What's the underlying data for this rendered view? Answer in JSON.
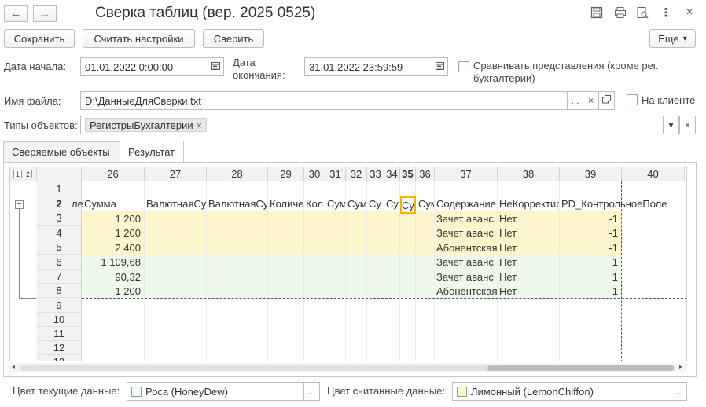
{
  "window": {
    "title": "Сверка таблиц (вер. 2025 0525)",
    "nav_back": "←",
    "nav_forward": "→",
    "menu_icon": "⋮",
    "close_icon": "×"
  },
  "toolbar": {
    "save": "Сохранить",
    "read_settings": "Считать настройки",
    "compare": "Сверить",
    "more": "Еще",
    "more_caret": "▾"
  },
  "form": {
    "start_label": "Дата начала:",
    "start_value": "01.01.2022  0:00:00",
    "end_label_1": "Дата",
    "end_label_2": "окончания:",
    "end_value": "31.01.2022 23:59:59",
    "compare_repr_1": "Сравнивать представления (кроме рег.",
    "compare_repr_2": "бухгалтерии)",
    "file_label": "Имя файла:",
    "file_value": "D:\\ДанныеДляСверки.txt",
    "file_btn_select": "...",
    "file_btn_clear": "×",
    "on_client": "На клиенте",
    "types_label": "Типы объектов:",
    "types_tag": "РегистрыБухгалтерии",
    "tag_remove": "×",
    "types_dropdown": "▾",
    "types_clear": "×"
  },
  "tabs": [
    {
      "label": "Сверяемые объекты",
      "active": false
    },
    {
      "label": "Результат",
      "active": true
    }
  ],
  "grid": {
    "level_buttons": [
      "1",
      "2"
    ],
    "columns": [
      "26",
      "27",
      "28",
      "29",
      "30",
      "31",
      "32",
      "33",
      "34",
      "35",
      "36",
      "37",
      "38",
      "39",
      "40"
    ],
    "selected_column": "35",
    "rows": [
      "1",
      "2",
      "3",
      "4",
      "5",
      "6",
      "7",
      "8",
      "9",
      "10",
      "11",
      "12",
      "13"
    ],
    "selected_row": "2",
    "header_row": [
      "ле",
      "Сумма",
      "ВалютнаяСу",
      "ВалютнаяСу",
      "Количе",
      "Кол",
      "Сум",
      "Сум",
      "Су",
      "Су",
      "Су",
      "Сум",
      "Содержание",
      "НеКорректир",
      "PD_КонтрольноеПоле"
    ],
    "data_rows": [
      {
        "sum": "1 200",
        "content": "Зачет аванс",
        "incorrect": "Нет",
        "control": "-1",
        "color": "#fdf6cc"
      },
      {
        "sum": "1 200",
        "content": "Зачет аванс",
        "incorrect": "Нет",
        "control": "-1",
        "color": "#fdf6cc"
      },
      {
        "sum": "2 400",
        "content": "Абонентская",
        "incorrect": "Нет",
        "control": "-1",
        "color": "#fdf6cc"
      },
      {
        "sum": "1 109,68",
        "content": "Зачет аванс",
        "incorrect": "Нет",
        "control": "1",
        "color": "#eef9ea"
      },
      {
        "sum": "90,32",
        "content": "Зачет аванс",
        "incorrect": "Нет",
        "control": "1",
        "color": "#eef9ea"
      },
      {
        "sum": "1 200",
        "content": "Абонентская",
        "incorrect": "Нет",
        "control": "1",
        "color": "#eef9ea"
      }
    ]
  },
  "bottom": {
    "current_label": "Цвет текущие данные:",
    "current_value": "Роса (HoneyDew)",
    "current_swatch": "#f0fff0",
    "read_label": "Цвет считанные данные:",
    "read_value": "Лимонный (LemonChiffon)",
    "read_swatch": "#fffacd",
    "select_btn": "..."
  }
}
